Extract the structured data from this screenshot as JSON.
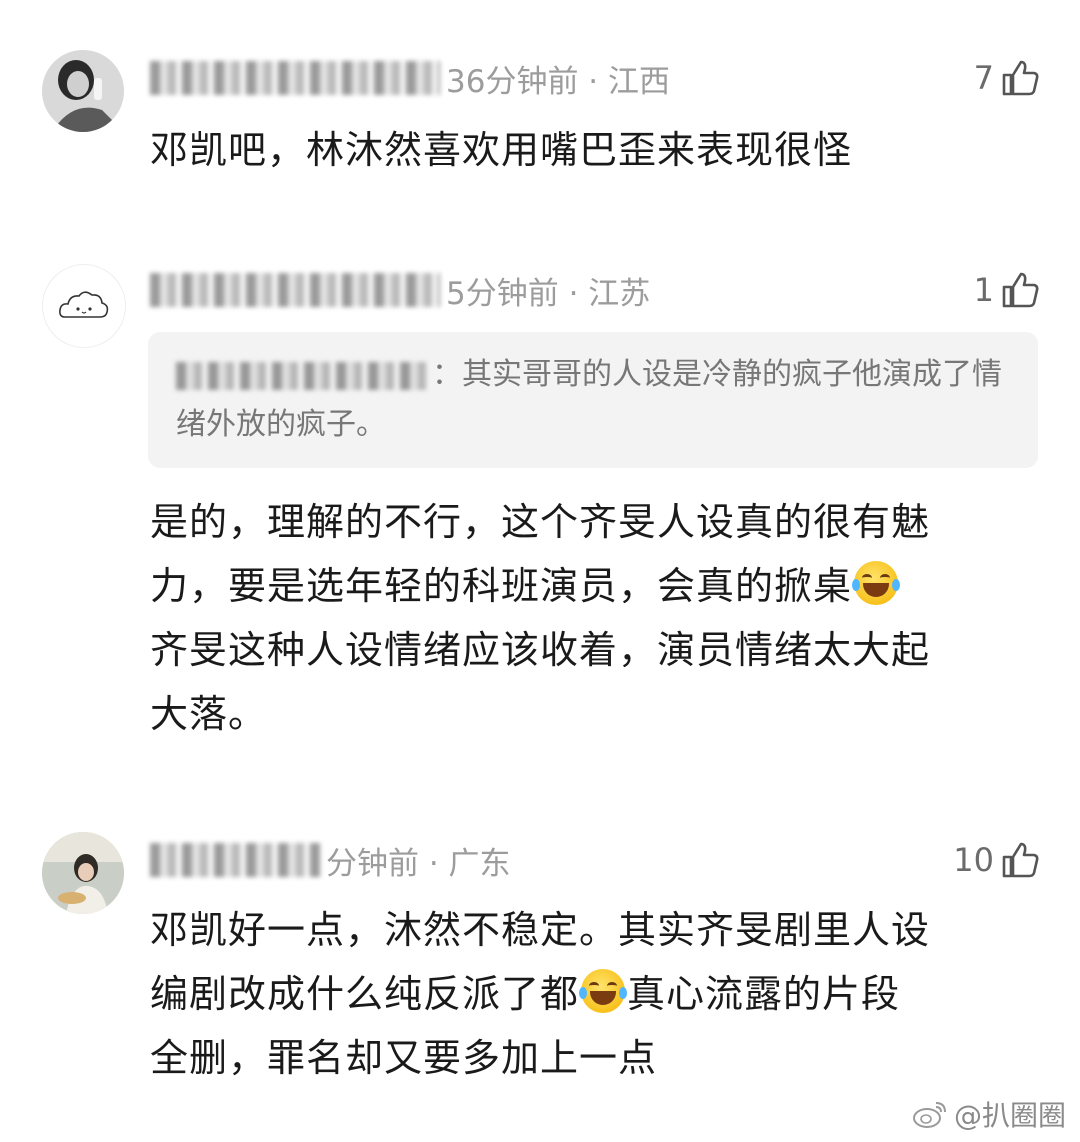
{
  "comments": [
    {
      "time_location": "36分钟前 · 江西",
      "likes": "7",
      "text": "邓凯吧，林沐然喜欢用嘴巴歪来表现很怪"
    },
    {
      "time_location": "5分钟前 · 江苏",
      "likes": "1",
      "quote": "：其实哥哥的人设是冷静的疯子他演成了情绪外放的疯子。",
      "text_lines": [
        "是的，理解的不行，这个齐旻人设真的很有魅",
        "力，要是选年轻的科班演员，会真的掀桌",
        "齐旻这种人设情绪应该收着，演员情绪太大起",
        "大落。"
      ]
    },
    {
      "time_location": "分钟前 · 广东",
      "likes": "10",
      "text_lines": [
        "邓凯好一点，沐然不稳定。其实齐旻剧里人设",
        "编剧改成什么纯反派了都",
        "真心流露的片段",
        "全删，罪名却又要多加上一点"
      ]
    }
  ],
  "watermark": "@扒圈圈",
  "icons": {
    "like": "thumbs-up-icon",
    "emoji": "tears-of-joy-emoji",
    "weibo": "weibo-logo-icon"
  }
}
